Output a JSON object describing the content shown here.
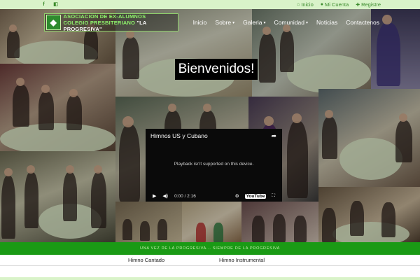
{
  "topbar": {
    "social": [
      {
        "icon": "facebook-icon",
        "glyph": "f"
      },
      {
        "icon": "flickr-icon",
        "glyph": "◧"
      }
    ],
    "links": [
      {
        "icon": "home-icon",
        "glyph": "⌂",
        "label": "Inicio"
      },
      {
        "icon": "user-icon",
        "glyph": "●",
        "label": "Mi Cuenta"
      },
      {
        "icon": "register-icon",
        "glyph": "✚",
        "label": "Registre"
      }
    ]
  },
  "logo": {
    "line1": "ASOCIACION DE EX-ALUMNOS",
    "line2": "COLEGIO PRESBITERIANO",
    "line2_quote": " \"LA PROGRESIVA\"",
    "emblem": "◆"
  },
  "nav": {
    "items": [
      {
        "label": "Inicio",
        "dropdown": false
      },
      {
        "label": "Sobre",
        "dropdown": true
      },
      {
        "label": "Galeria",
        "dropdown": true
      },
      {
        "label": "Comunidad",
        "dropdown": true
      },
      {
        "label": "Noticias",
        "dropdown": false
      },
      {
        "label": "Contactenos",
        "dropdown": false
      }
    ],
    "caret": "▾"
  },
  "hero": {
    "welcome": "Bienvenidos!"
  },
  "video": {
    "title": "Himnos US y Cubano",
    "share_glyph": "➦",
    "message": "Playback isn't supported on this device.",
    "play_glyph": "▶",
    "volume_glyph": "◀)",
    "time": "0:00 / 2:16",
    "settings_glyph": "⚙",
    "youtube_label": "YouTube",
    "fullscreen_glyph": "⛶"
  },
  "tagline": "UNA VEZ DE LA PROGRESIVA... SIEMPRE DE LA PROGRESIVA",
  "tabs": [
    "Himno Cantado",
    "Himno Instrumental"
  ],
  "colors": {
    "accent_green": "#1a9a15",
    "light_green": "#d9f3c9",
    "logo_green": "#8ef26b"
  }
}
